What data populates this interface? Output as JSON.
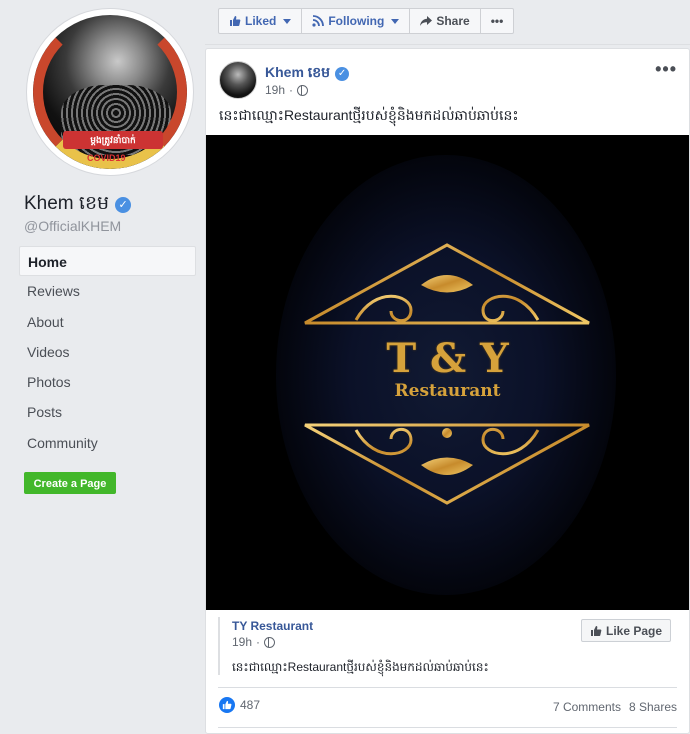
{
  "profile": {
    "name": "Khem ខេម",
    "handle": "@OfficialKHEM",
    "picture_banner_text": "ម្ដងត្រូវនាំបាក់",
    "picture_covid_text": "COVID19"
  },
  "nav": {
    "items": [
      {
        "label": "Home",
        "active": true
      },
      {
        "label": "Reviews"
      },
      {
        "label": "About"
      },
      {
        "label": "Videos"
      },
      {
        "label": "Photos"
      },
      {
        "label": "Posts"
      },
      {
        "label": "Community"
      }
    ],
    "create_page_label": "Create a Page"
  },
  "action_bar": {
    "liked_label": "Liked",
    "following_label": "Following",
    "share_label": "Share",
    "more_label": "•••"
  },
  "post": {
    "author": "Khem ខេម",
    "time": "19h",
    "menu": "•••",
    "text": "នេះជាឈ្មោះRestaurantថ្មីរបស់ខ្ញុំនិងមកដល់ឆាប់ឆាប់នេះ",
    "image": {
      "logo_title": "T & Y",
      "logo_subtitle": "Restaurant"
    },
    "shared": {
      "page_name": "TY Restaurant",
      "time": "19h",
      "text": "នេះជាឈ្មោះRestaurantថ្មីរបស់ខ្ញុំនិងមកដល់ឆាប់ឆាប់នេះ",
      "like_page_label": "Like Page"
    },
    "reactions_count": "487",
    "comments_label": "7 Comments",
    "shares_label": "8 Shares"
  },
  "colors": {
    "link_blue": "#385898",
    "accent_blue": "#4267b2",
    "green_button": "#42b72a",
    "gold": "#d6a23b"
  }
}
